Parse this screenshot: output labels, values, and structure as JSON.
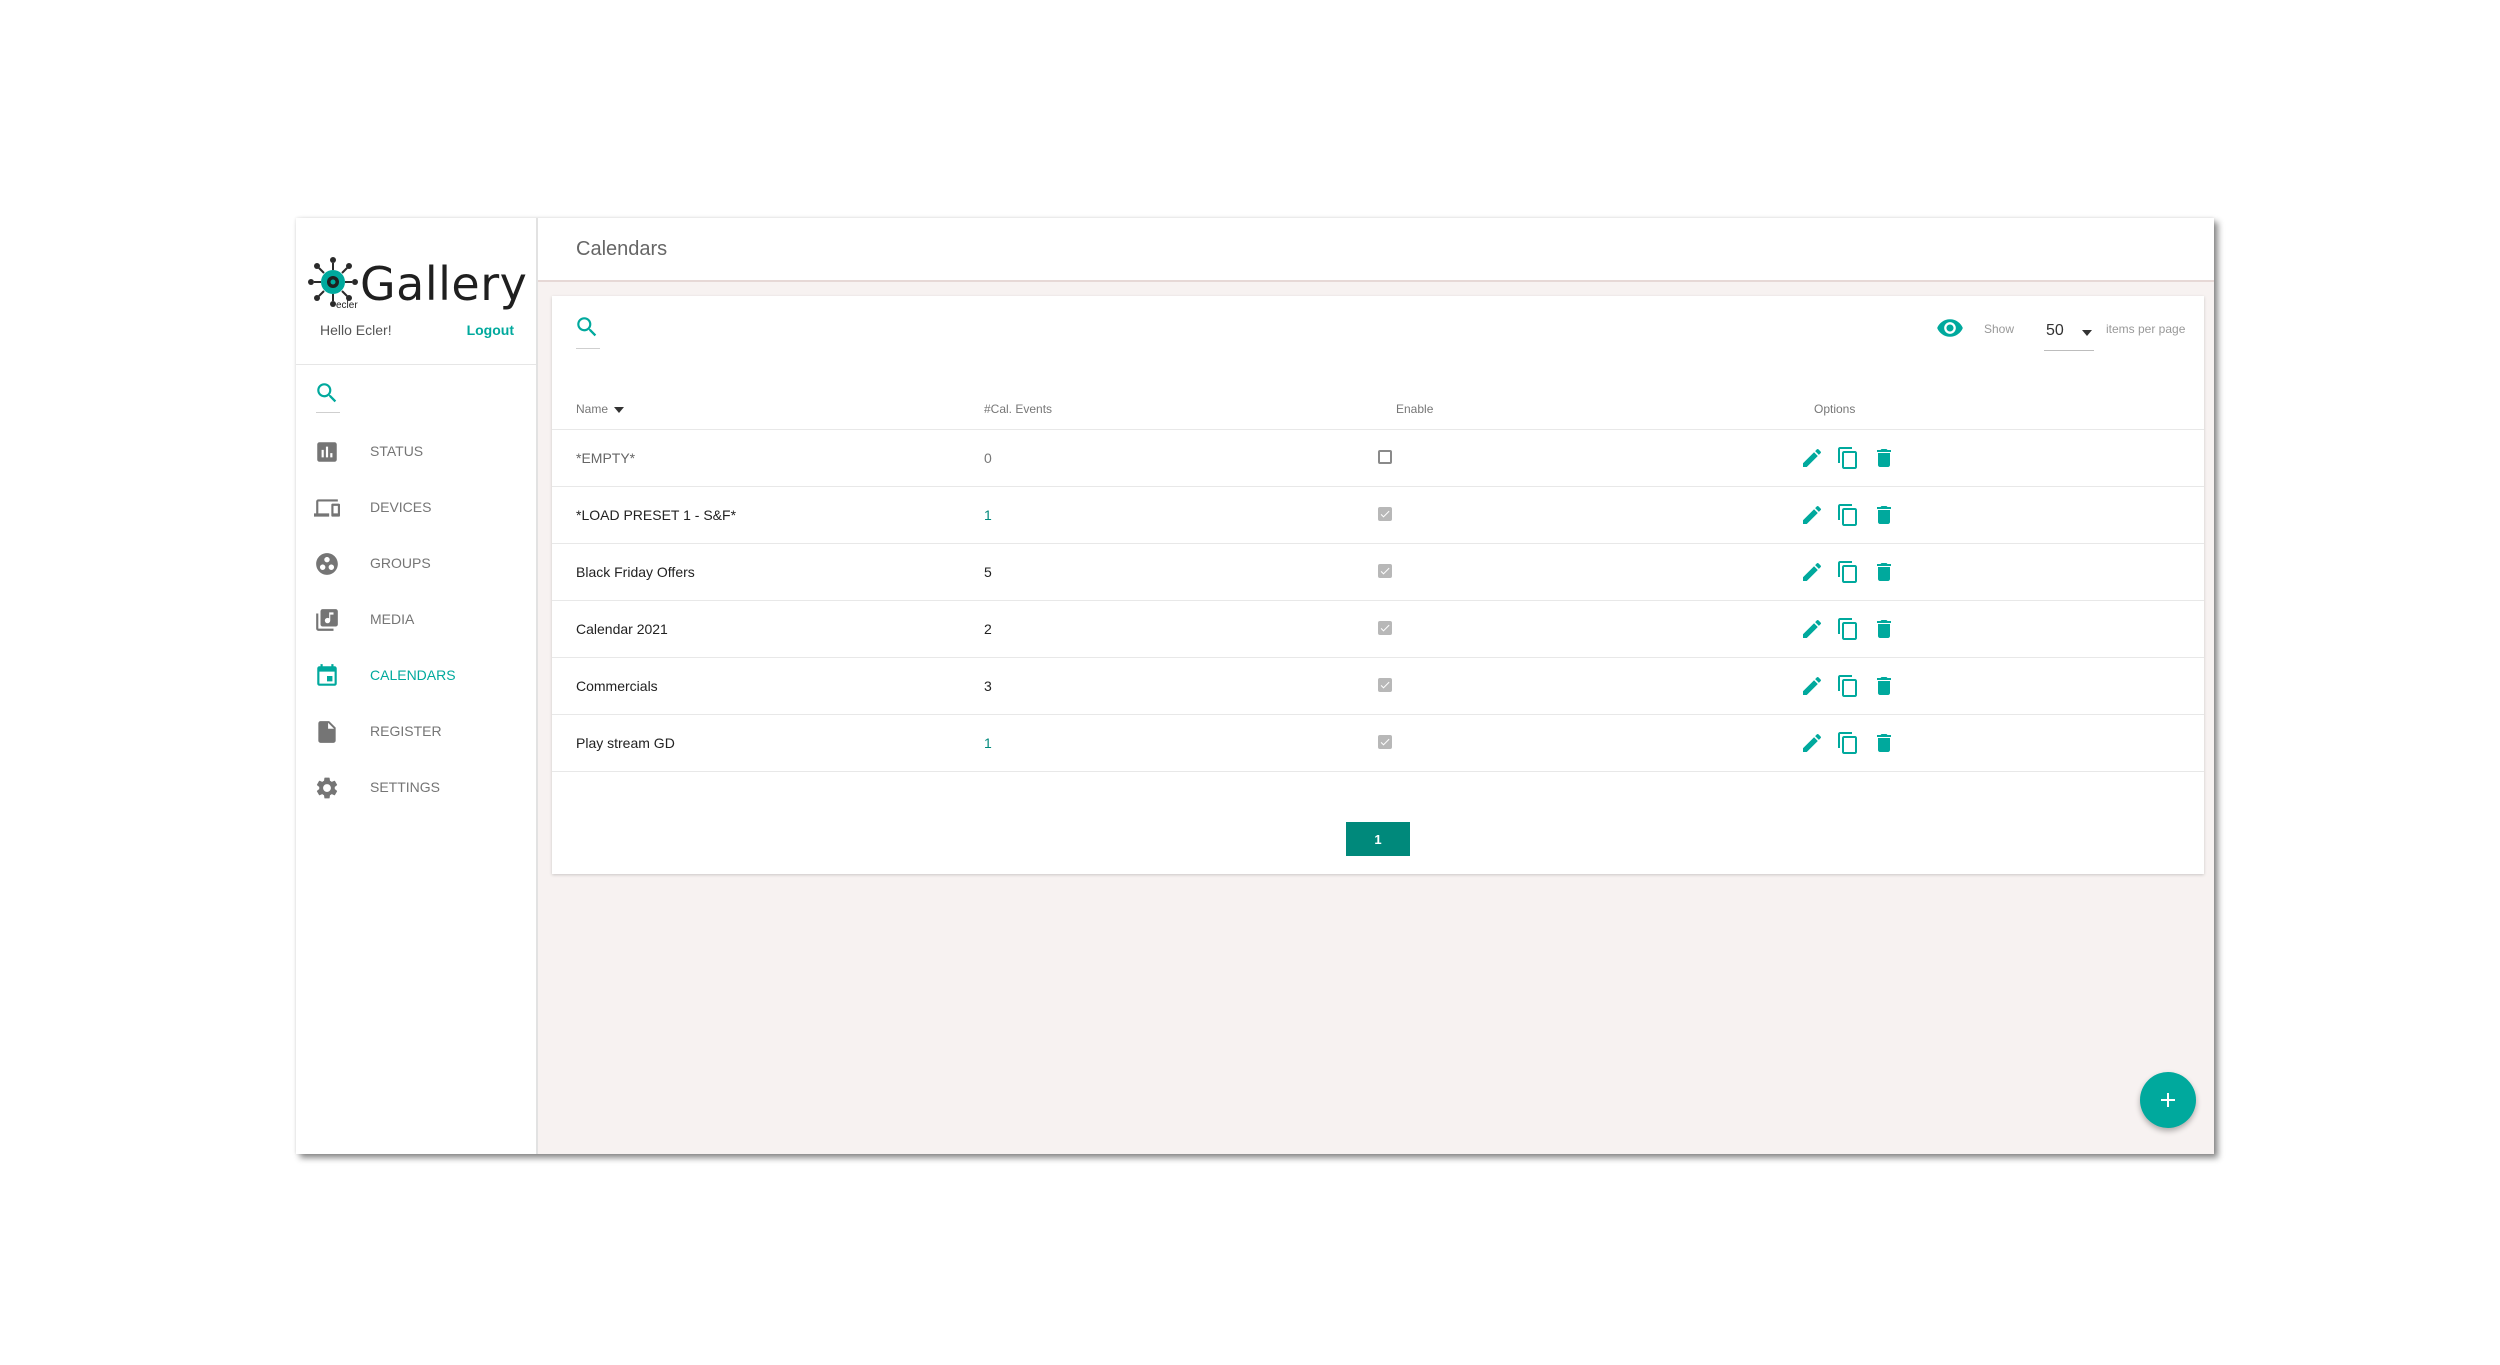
{
  "app": {
    "logo_text": "Gallery",
    "logo_sub": "ecler",
    "greeting": "Hello Ecler!",
    "logout_label": "Logout"
  },
  "colors": {
    "accent": "#00a99d",
    "accent_dark": "#00897b",
    "background": "#f7f2f1"
  },
  "sidebar": {
    "items": [
      {
        "label": "STATUS",
        "icon": "bar-chart-icon"
      },
      {
        "label": "DEVICES",
        "icon": "devices-icon"
      },
      {
        "label": "GROUPS",
        "icon": "groups-icon"
      },
      {
        "label": "MEDIA",
        "icon": "media-library-icon"
      },
      {
        "label": "CALENDARS",
        "icon": "calendar-icon",
        "active": true
      },
      {
        "label": "REGISTER",
        "icon": "file-icon"
      },
      {
        "label": "SETTINGS",
        "icon": "gear-icon"
      }
    ]
  },
  "header": {
    "title": "Calendars"
  },
  "toolbar": {
    "show_label": "Show",
    "items_per_page": "50",
    "items_label": "items per page"
  },
  "table": {
    "columns": [
      "Name",
      "#Cal. Events",
      "Enable",
      "Options"
    ],
    "rows": [
      {
        "name": "*EMPTY*",
        "events": "0",
        "enabled": false
      },
      {
        "name": "*LOAD PRESET 1 - S&F*",
        "events": "1",
        "enabled": true
      },
      {
        "name": "Black Friday Offers",
        "events": "5",
        "enabled": true
      },
      {
        "name": "Calendar 2021",
        "events": "2",
        "enabled": true
      },
      {
        "name": "Commercials",
        "events": "3",
        "enabled": true
      },
      {
        "name": "Play stream GD",
        "events": "1",
        "enabled": true
      }
    ]
  },
  "pagination": {
    "current_page": "1"
  }
}
